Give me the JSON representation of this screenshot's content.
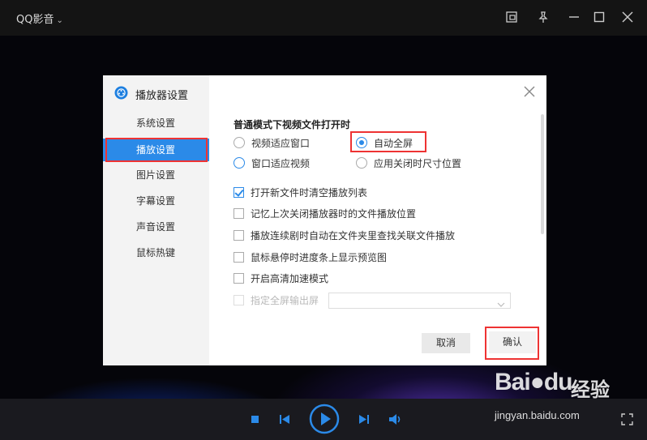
{
  "app": {
    "title": "QQ影音"
  },
  "dialog": {
    "title": "播放器设置",
    "nav": [
      {
        "label": "系统设置"
      },
      {
        "label": "播放设置"
      },
      {
        "label": "图片设置"
      },
      {
        "label": "字幕设置"
      },
      {
        "label": "声音设置"
      },
      {
        "label": "鼠标热键"
      }
    ],
    "active_nav": "播放设置",
    "section_title": "普通模式下视频文件打开时",
    "radios": [
      {
        "label": "视频适应窗口",
        "selected": false
      },
      {
        "label": "自动全屏",
        "selected": true
      },
      {
        "label": "窗口适应视频",
        "selected": false
      },
      {
        "label": "应用关闭时尺寸位置",
        "selected": false
      }
    ],
    "checkboxes": [
      {
        "label": "打开新文件时清空播放列表",
        "checked": true
      },
      {
        "label": "记忆上次关闭播放器时的文件播放位置",
        "checked": false
      },
      {
        "label": "播放连续剧时自动在文件夹里查找关联文件播放",
        "checked": false
      },
      {
        "label": "鼠标悬停时进度条上显示预览图",
        "checked": false
      },
      {
        "label": "开启高清加速模式",
        "checked": false
      },
      {
        "label": "指定全屏输出屏",
        "checked": false,
        "disabled": true
      }
    ],
    "select_value": "",
    "cancel_label": "取消",
    "ok_label": "确认"
  },
  "watermark": {
    "brand_left": "Bai",
    "brand_right": "du",
    "brand_cn": "经验",
    "url": "jingyan.baidu.com"
  },
  "colors": {
    "accent": "#2b8ae8",
    "highlight": "#e33333",
    "titlebar": "#141414",
    "controlbar": "#1a1a1f"
  },
  "icons": [
    "chevron-down-icon",
    "mini-mode-icon",
    "pin-icon",
    "minimize-icon",
    "maximize-icon",
    "close-icon",
    "qq-player-logo-icon",
    "stop-icon",
    "previous-icon",
    "play-icon",
    "next-icon",
    "volume-icon",
    "fullscreen-icon"
  ]
}
